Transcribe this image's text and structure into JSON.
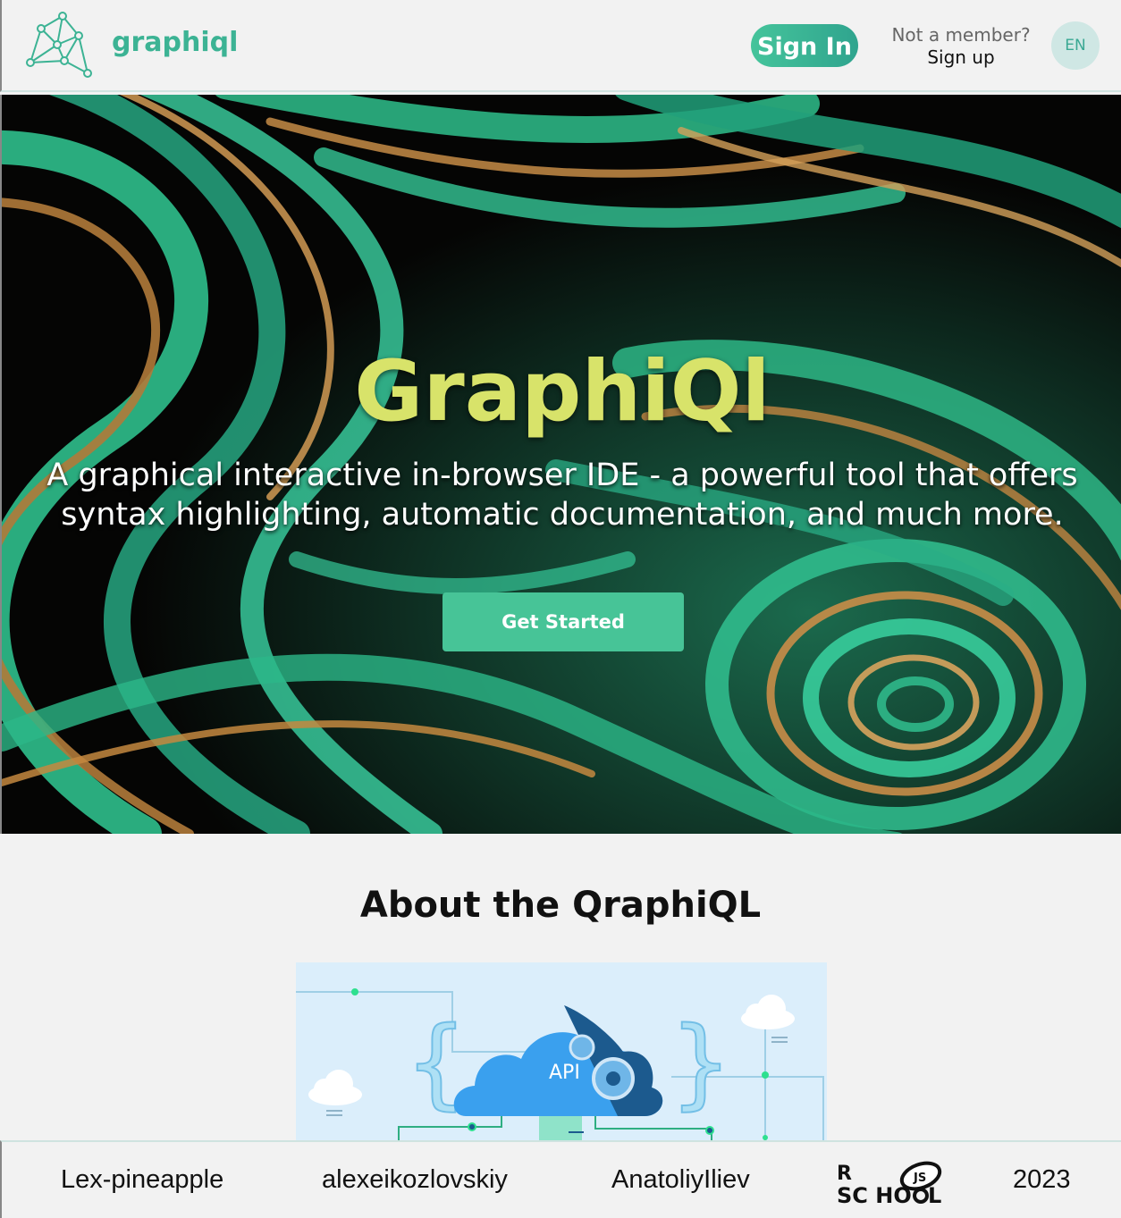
{
  "header": {
    "brand": "graphiql",
    "sign_in": "Sign In",
    "not_member": "Not a member?",
    "sign_up": "Sign up",
    "lang": "EN"
  },
  "hero": {
    "title": "GraphiQl",
    "subtitle_line1": "A graphical interactive in-browser IDE - a powerful tool that offers",
    "subtitle_line2": "syntax highlighting, automatic documentation, and much more.",
    "cta": "Get Started"
  },
  "about": {
    "title": "About the QraphiQL",
    "illustration_label": "API"
  },
  "footer": {
    "authors": [
      "Lex-pineapple",
      "alexeikozlovskiy",
      "AnatoliyIliev"
    ],
    "school_logo": "RS SCHOOL JS",
    "year": "2023"
  },
  "colors": {
    "accent": "#3cb394",
    "hero_title": "#d8e36a",
    "cta": "#47c497"
  }
}
